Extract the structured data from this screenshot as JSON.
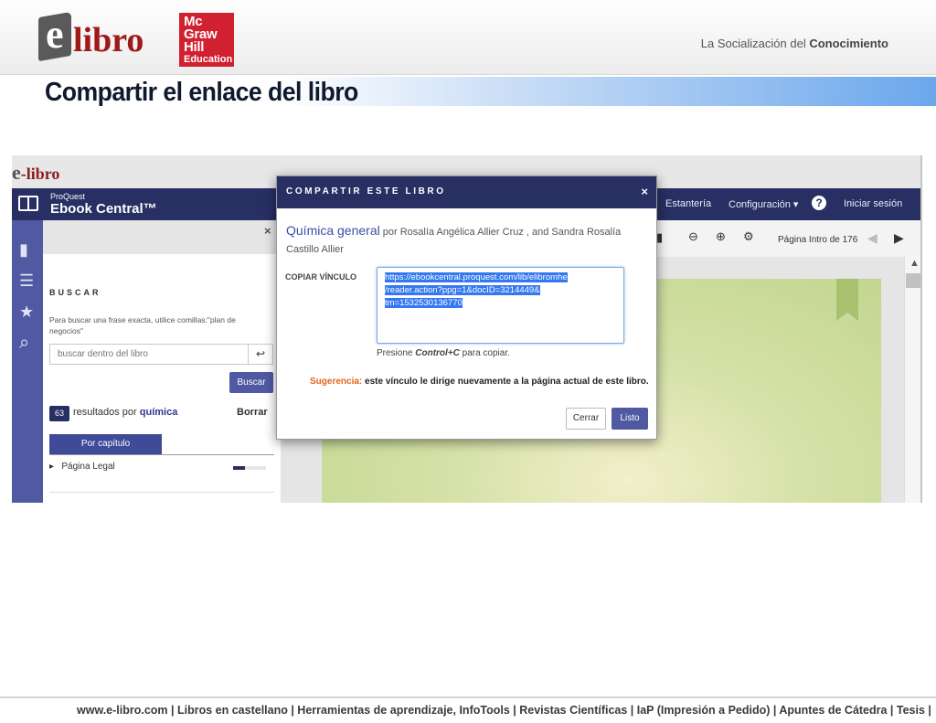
{
  "slide": {
    "logo_text": "libro",
    "logo_e": "e",
    "mgh": [
      "Mc",
      "Graw",
      "Hill",
      "Education"
    ],
    "tagline_pre": "La Socialización del",
    "tagline_bold": "Conocimiento",
    "title": "Compartir el enlace del libro",
    "footer": "www.e-libro.com | Libros en castellano | Herramientas de aprendizaje, InfoTools | Revistas Científicas | IaP (Impresión a Pedido) | Apuntes de Cátedra | Tesis |"
  },
  "app": {
    "mini_logo_e": "e",
    "mini_logo_text": "-libro",
    "brand_small": "ProQuest",
    "brand_title": "Ebook Central™",
    "nav": [
      "Estantería",
      "Configuración ▾",
      "Iniciar sesión"
    ],
    "help": "?",
    "sidebar": {
      "close": "×",
      "heading": "BUSCAR",
      "help_text": "Para buscar una frase exacta, utilice comillas:\"plan de negocios\"",
      "search_placeholder": "buscar dentro del libro",
      "enter_symbol": "↩",
      "search_button": "Buscar",
      "result_count": "63",
      "results_prefix": "resultados por",
      "results_term": "química",
      "clear": "Borrar",
      "tab": "Por capítulo",
      "chapter": "Página Legal",
      "chapter_arrow": "▸",
      "chapter_progress": 0.35
    },
    "toolbar": {
      "page_prefix": "Página",
      "page_value": "Intro",
      "page_of": "de 176",
      "prev": "◀",
      "next": "▶"
    },
    "modal": {
      "title": "COMPARTIR ESTE LIBRO",
      "close": "×",
      "book_title": "Química general",
      "book_by": "por Rosalía Angélica Allier Cruz , and Sandra Rosalía Castillo Allier",
      "copy_label": "COPIAR VÍNCULO",
      "link_lines": [
        "https://ebookcentral.proquest.com/lib/elibromhe",
        "/reader.action?ppg=1&docID=3214449&",
        "tm=1532530136770"
      ],
      "hint_pre": "Presione",
      "hint_key": "Control+C",
      "hint_post": "para copiar.",
      "suggestion_label": "Sugerencia:",
      "suggestion_text": "este vínculo le dirige nuevamente a la página actual de este libro.",
      "cancel": "Cerrar",
      "ok": "Listo"
    }
  },
  "colors": {
    "navy": "#272f63",
    "accent": "#4f5aa3",
    "mgh_red": "#d1202f",
    "elibro_red": "#a01818",
    "suggestion_orange": "#e2641c"
  }
}
